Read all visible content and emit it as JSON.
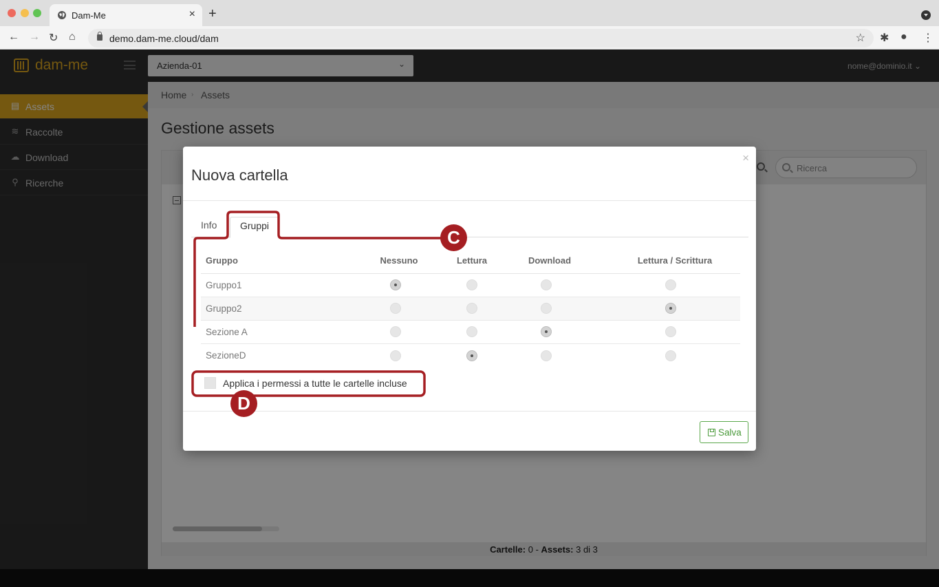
{
  "browser": {
    "tab_title": "Dam-Me",
    "tab_close": "×",
    "new_tab": "+",
    "url": "demo.dam-me.cloud/dam",
    "nav": {
      "back": "←",
      "forward": "→",
      "reload": "↻",
      "home": "⌂"
    },
    "star": "☆",
    "extensions": "✱",
    "profile": "●",
    "menu": "⋮",
    "traffic_colors": [
      "#ed6a5e",
      "#f5bf4f",
      "#61c454"
    ]
  },
  "header": {
    "logo_text": "dam-me",
    "company_select": "Azienda-01",
    "company_chevron": "⌄",
    "user_menu": "nome@dominio.it ⌄",
    "brand_color": "#e0a91f"
  },
  "sidebar": {
    "items": [
      {
        "label": "Assets",
        "icon": "copy-icon",
        "glyph": "▤",
        "active": true
      },
      {
        "label": "Raccolte",
        "icon": "layers-icon",
        "glyph": "≋",
        "active": false
      },
      {
        "label": "Download",
        "icon": "cloud-download-icon",
        "glyph": "☁",
        "active": false
      },
      {
        "label": "Ricerche",
        "icon": "search-icon",
        "glyph": "⚲",
        "active": false
      }
    ]
  },
  "main": {
    "breadcrumb": [
      "Home",
      "Assets"
    ],
    "breadcrumb_sep": "›",
    "page_title": "Gestione assets",
    "search_placeholder": "Ricerca",
    "footer": {
      "folders_label": "Cartelle:",
      "folders_value": "0",
      "sep": " - ",
      "assets_label": "Assets:",
      "assets_value": "3 di 3"
    }
  },
  "modal": {
    "title": "Nuova cartella",
    "close": "×",
    "tabs": [
      {
        "label": "Info",
        "active": false
      },
      {
        "label": "Gruppi",
        "active": true
      }
    ],
    "columns": [
      "Gruppo",
      "Nessuno",
      "Lettura",
      "Download",
      "Lettura / Scrittura"
    ],
    "rows": [
      {
        "name": "Gruppo1",
        "selected": "Nessuno"
      },
      {
        "name": "Gruppo2",
        "selected": "Lettura / Scrittura"
      },
      {
        "name": "Sezione A",
        "selected": "Download"
      },
      {
        "name": "SezioneD",
        "selected": "Lettura"
      }
    ],
    "apply_label": "Applica i permessi a tutte le cartelle incluse",
    "save_label": "Salva"
  },
  "annotations": {
    "color": "#a51e22",
    "badges": [
      "C",
      "D"
    ]
  }
}
